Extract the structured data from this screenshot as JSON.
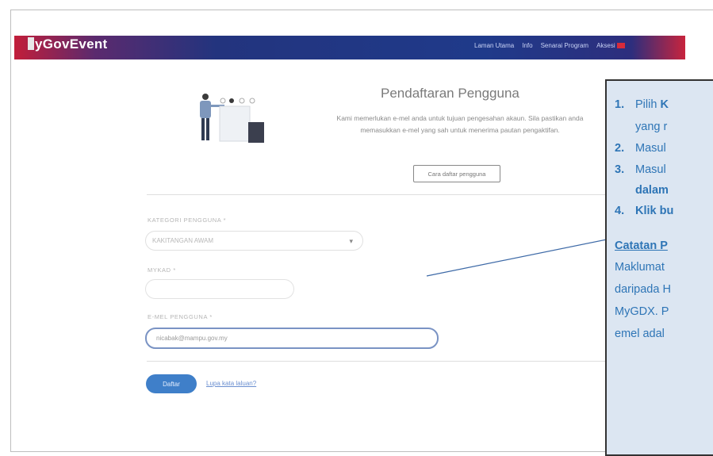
{
  "header": {
    "logo_initial": "M",
    "logo_text": "yGovEvent",
    "nav_links": [
      "Laman Utama",
      "Info",
      "Senarai Program",
      "Aksesi"
    ],
    "brand_colors": {
      "navbar_start": "#c21e3a",
      "navbar_mid": "#1f3a8a",
      "navbar_end": "#c8243d"
    }
  },
  "registration": {
    "stepper_current": 2,
    "stepper_total": 4,
    "title": "Pendaftaran Pengguna",
    "description": "Kami memerlukan e-mel anda untuk tujuan pengesahan akaun. Sila pastikan anda memasukkan e-mel yang sah untuk menerima pautan pengaktifan.",
    "guide_button": "Cara daftar pengguna"
  },
  "form": {
    "category_label": "KATEGORI PENGGUNA *",
    "category_value": "KAKITANGAN AWAM",
    "nric_label": "MYKAD *",
    "nric_value": "",
    "email_label": "E-MEL PENGGUNA *",
    "email_value": "nicabak@mampu.gov.my",
    "submit_label": "Daftar",
    "help_link": "Lupa kata laluan?"
  },
  "callout": {
    "steps": [
      {
        "num": "1.",
        "prefix": "Pilih ",
        "bold": "K",
        "suffix": ""
      },
      {
        "num": "",
        "prefix": "yang r",
        "bold": "",
        "suffix": ""
      },
      {
        "num": "2.",
        "prefix": "Masul",
        "bold": "",
        "suffix": ""
      },
      {
        "num": "3.",
        "prefix": "Masul",
        "bold": "",
        "suffix": ""
      },
      {
        "num": "",
        "prefix": "",
        "bold": "dalam",
        "suffix": ""
      },
      {
        "num": "4.",
        "prefix": "",
        "bold": "Klik bu",
        "suffix": ""
      }
    ],
    "note_heading": "Catatan P",
    "note_lines": [
      "Maklumat",
      "daripada H",
      "MyGDX. P",
      "emel adal"
    ],
    "accent_color": "#2e75b6",
    "background_color": "#dce6f2"
  }
}
